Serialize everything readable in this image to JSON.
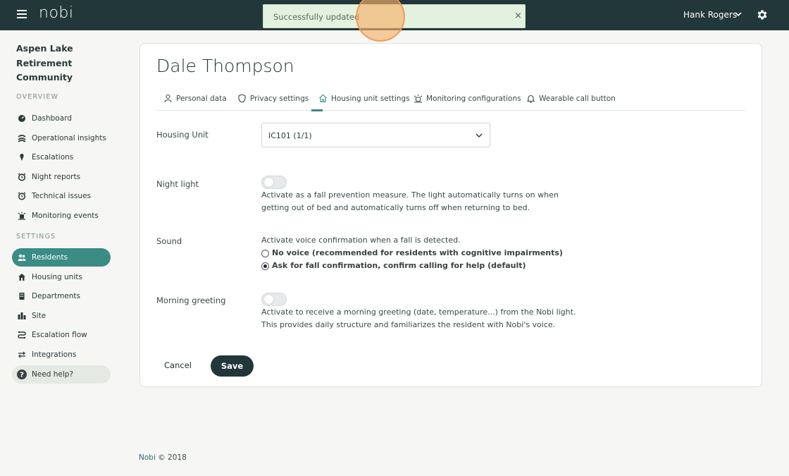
{
  "topbar": {
    "logo": "nobi",
    "user_name": "Hank Rogers",
    "bg_color": "#22373a"
  },
  "toast": {
    "message": "Successfully updated",
    "close": "×"
  },
  "sidebar": {
    "community": "Aspen Lake Retirement Community",
    "overview_title": "OVERVIEW",
    "overview_items": [
      {
        "label": "Dashboard",
        "icon": "dashboard-icon"
      },
      {
        "label": "Operational insights",
        "icon": "insights-icon"
      },
      {
        "label": "Escalations",
        "icon": "escalation-pin-icon"
      },
      {
        "label": "Night reports",
        "icon": "alarm-clock-icon"
      },
      {
        "label": "Technical issues",
        "icon": "alarm-clock-icon"
      },
      {
        "label": "Monitoring events",
        "icon": "monitoring-icon"
      }
    ],
    "settings_title": "SETTINGS",
    "settings_items": [
      {
        "label": "Residents",
        "icon": "users-icon",
        "active": true
      },
      {
        "label": "Housing units",
        "icon": "house-icon"
      },
      {
        "label": "Departments",
        "icon": "building-icon"
      },
      {
        "label": "Site",
        "icon": "city-icon"
      },
      {
        "label": "Escalation flow",
        "icon": "flow-icon"
      },
      {
        "label": "Integrations",
        "icon": "swap-arrows-icon"
      }
    ],
    "help_label": "Need help?",
    "accent_color": "#3a8c85"
  },
  "main": {
    "resident_name": "Dale Thompson",
    "tabs": [
      {
        "label": "Personal data",
        "icon": "person-icon"
      },
      {
        "label": "Privacy settings",
        "icon": "shield-icon"
      },
      {
        "label": "Housing unit settings",
        "icon": "home-icon",
        "active": true
      },
      {
        "label": "Monitoring configurations",
        "icon": "monitor-alert-icon"
      },
      {
        "label": "Wearable call button",
        "icon": "bell-icon"
      }
    ],
    "housing_unit": {
      "label": "Housing Unit",
      "value": "IC101 (1/1)"
    },
    "night_light": {
      "label": "Night light",
      "enabled": false,
      "description": "Activate as a fall prevention measure. The light automatically turns on when getting out of bed and automatically turns off when returning to bed."
    },
    "sound": {
      "label": "Sound",
      "description": "Activate voice confirmation when a fall is detected.",
      "options": [
        {
          "label": "No voice (recommended for residents with cognitive impairments)",
          "checked": false
        },
        {
          "label": "Ask for fall confirmation, confirm calling for help (default)",
          "checked": true
        }
      ]
    },
    "morning_greeting": {
      "label": "Morning greeting",
      "enabled": false,
      "description_line1": "Activate to receive a morning greeting (date, temperature...) from the Nobi light.",
      "description_line2": "This provides daily structure and familiarizes the resident with Nobi's voice."
    },
    "cancel_label": "Cancel",
    "save_label": "Save"
  },
  "footer": {
    "brand": "Nobi",
    "copyright": "© 2018"
  }
}
